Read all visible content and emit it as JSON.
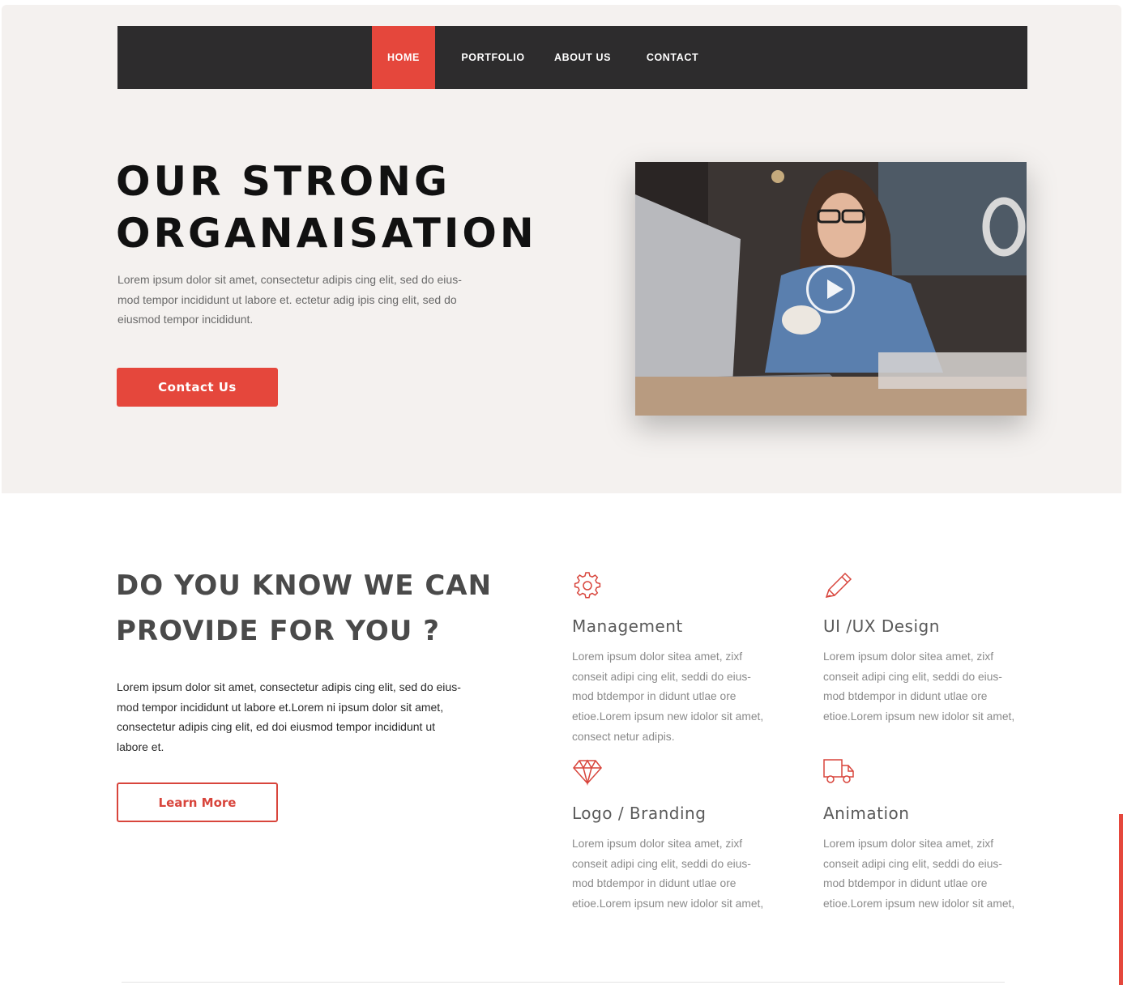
{
  "nav": {
    "items": [
      {
        "label": "HOME",
        "active": true
      },
      {
        "label": "PORTFOLIO",
        "active": false
      },
      {
        "label": "ABOUT US",
        "active": false
      },
      {
        "label": "CONTACT",
        "active": false
      }
    ]
  },
  "hero": {
    "title_line1": "OUR STRONG",
    "title_line2": "ORGANAISATION",
    "text_lines": [
      "Lorem ipsum dolor sit amet, consectetur adipis cing elit, sed do eius-",
      "mod tempor incididunt  ut labore et. ectetur adig ipis cing elit, sed do",
      "eiusmod tempor incididunt."
    ],
    "button_label": "Contact Us"
  },
  "about": {
    "title_line1": "DO YOU KNOW WE CAN",
    "title_line2": "PROVIDE FOR YOU ?",
    "text_lines": [
      "Lorem ipsum dolor sit amet, consectetur adipis cing elit, sed do eius-",
      "mod tempor incididunt ut labore et.Lorem ni ipsum dolor sit amet,",
      "consectetur adipis cing elit, ed doi eiusmod tempor incididunt ut",
      "labore et."
    ],
    "button_label": "Learn More"
  },
  "services": [
    {
      "icon": "gear-icon",
      "title": "Management",
      "lines": [
        "Lorem ipsum dolor sitea amet, zixf",
        "conseit  adipi cing elit, seddi do eius-",
        "mod btdempor in didunt utlae ore",
        "etioe.Lorem ipsum new idolor sit amet,",
        "consect netur adipis."
      ]
    },
    {
      "icon": "pencil-icon",
      "title": "UI /UX Design",
      "lines": [
        "Lorem ipsum dolor sitea amet, zixf",
        "conseit  adipi cing elit, seddi do eius-",
        "mod btdempor in didunt utlae ore",
        "etioe.Lorem ipsum new idolor sit amet,"
      ]
    },
    {
      "icon": "diamond-icon",
      "title": "Logo / Branding",
      "lines": [
        "Lorem ipsum dolor sitea amet, zixf",
        "conseit  adipi cing elit, seddi do eius-",
        "mod btdempor in didunt utlae ore",
        "etioe.Lorem ipsum new idolor sit amet,"
      ]
    },
    {
      "icon": "truck-icon",
      "title": "Animation",
      "lines": [
        "Lorem ipsum dolor sitea amet, zixf",
        "conseit  adipi cing elit, seddi do eius-",
        "mod btdempor in didunt utlae ore",
        "etioe.Lorem ipsum new idolor sit amet,"
      ]
    }
  ],
  "colors": {
    "accent": "#e5473c",
    "nav_background": "#2d2c2d",
    "hero_background": "#f4f1ef"
  }
}
